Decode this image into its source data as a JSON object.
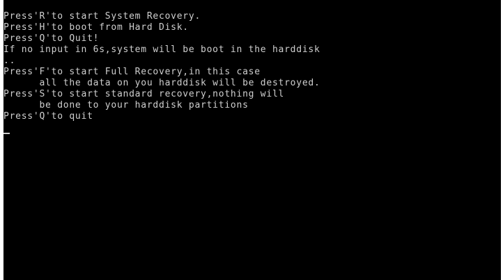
{
  "console": {
    "lines": [
      "Press'R'to start System Recovery.",
      "Press'H'to boot from Hard Disk.",
      "Press'Q'to Quit!",
      "If no input in 6s,system will be boot in the harddisk",
      "..",
      "Press'F'to start Full Recovery,in this case",
      "      all the data on you harddisk will be destroyed.",
      "Press'S'to start standard recovery,nothing will",
      "      be done to your harddisk partitions",
      "Press'Q'to quit"
    ]
  },
  "colors": {
    "background": "#000000",
    "text": "#cfcfcf"
  }
}
